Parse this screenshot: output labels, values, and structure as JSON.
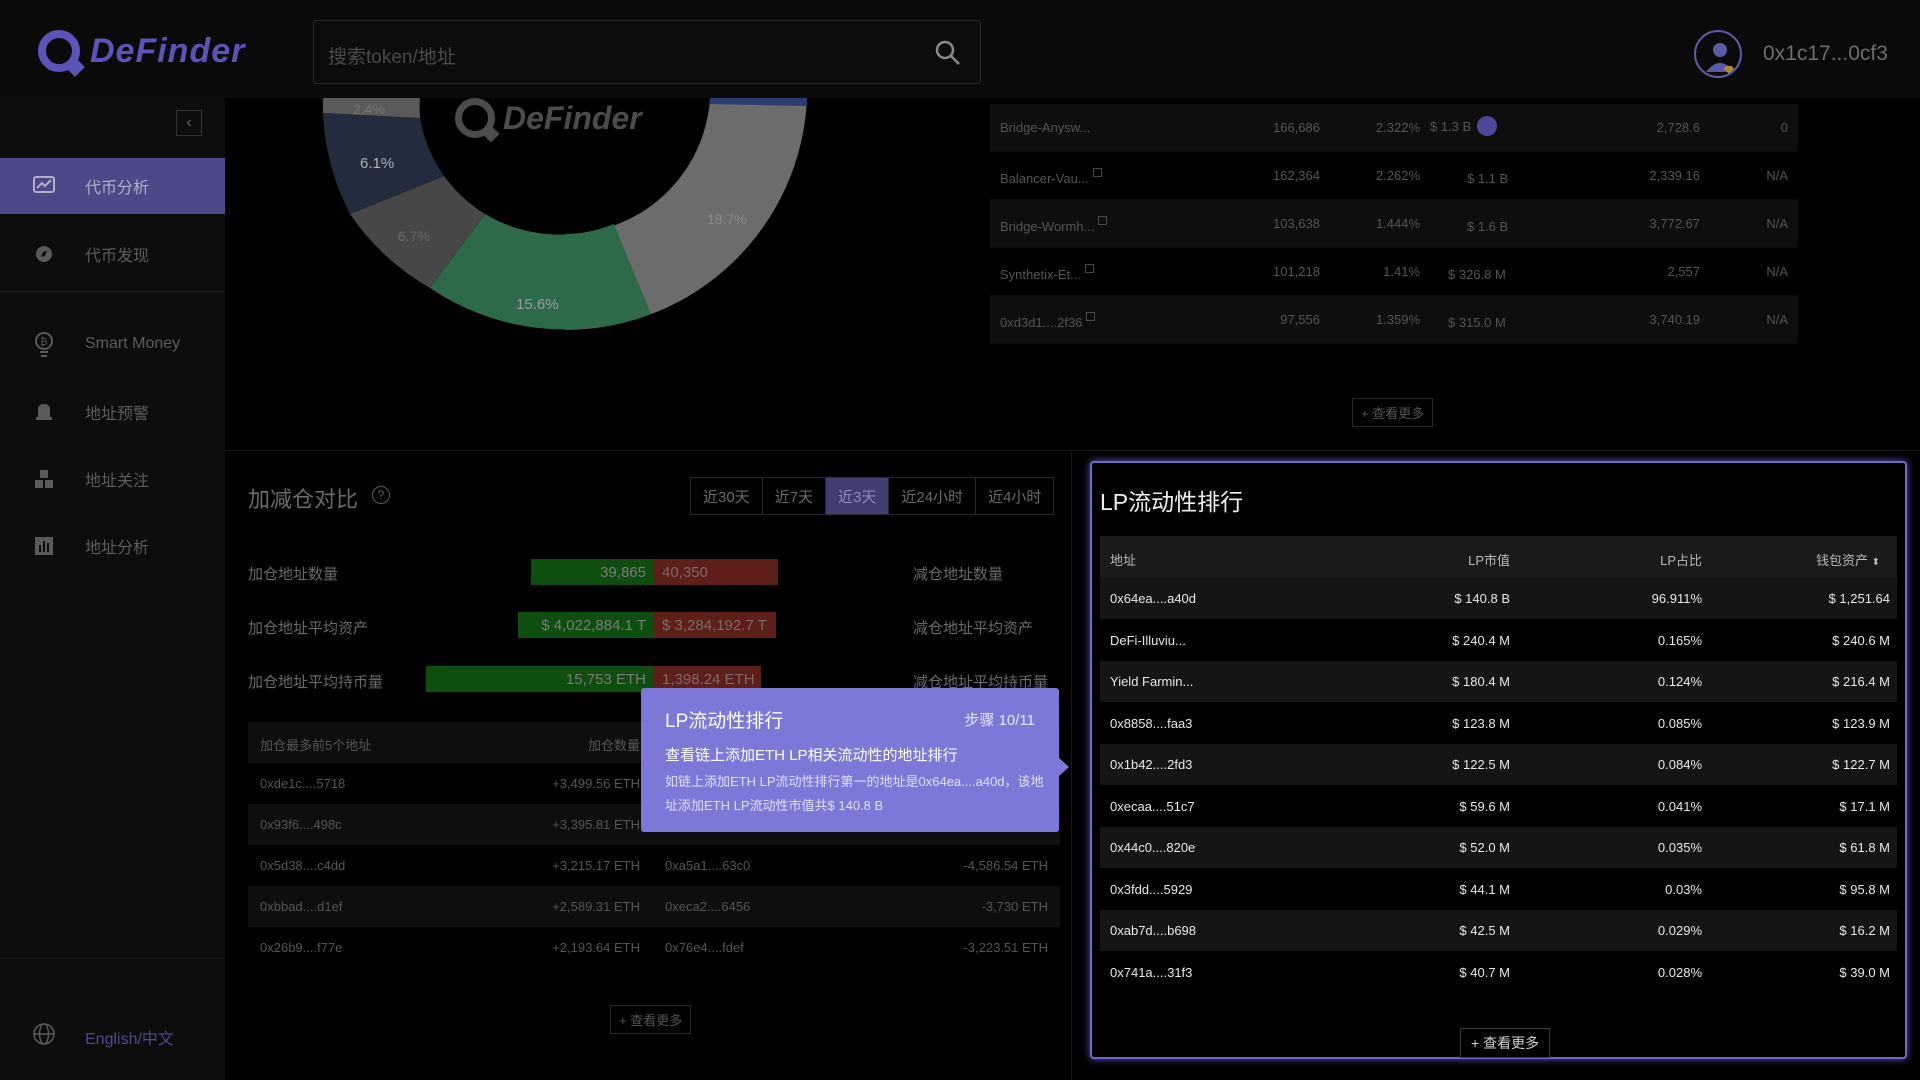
{
  "header": {
    "logo_text": "DeFinder",
    "search_placeholder": "搜索token/地址",
    "wallet_address": "0x1c17...0cf3"
  },
  "sidebar": {
    "items": [
      {
        "label": "代币分析",
        "icon": "chart-icon",
        "active": true
      },
      {
        "label": "代币发现",
        "icon": "compass-icon",
        "active": false
      },
      {
        "label": "Smart Money",
        "icon": "bulb-icon",
        "active": false
      },
      {
        "label": "地址预警",
        "icon": "bell-icon",
        "active": false
      },
      {
        "label": "地址关注",
        "icon": "cubes-icon",
        "active": false
      },
      {
        "label": "地址分析",
        "icon": "bar-chart-icon",
        "active": false
      }
    ],
    "language": "English/中文"
  },
  "donut": {
    "labels": [
      "2.4%",
      "6.1%",
      "6.7%",
      "15.6%",
      "18.7%"
    ]
  },
  "watermark_text": "DeFinder",
  "holders_table": {
    "rows": [
      {
        "name": "Bridge-Anysw...",
        "count": "166,686",
        "pct": "2.322%",
        "value": "$ 1.3 B",
        "num": "2,728.6",
        "extra": "0"
      },
      {
        "name": "Balancer-Vau...",
        "count": "162,364",
        "pct": "2.262%",
        "value": "$ 1.1 B",
        "num": "2,339.16",
        "extra": "N/A"
      },
      {
        "name": "Bridge-Wormh...",
        "count": "103,638",
        "pct": "1.444%",
        "value": "$ 1.6 B",
        "num": "3,772.67",
        "extra": "N/A"
      },
      {
        "name": "Synthetix-Et...",
        "count": "101,218",
        "pct": "1.41%",
        "value": "$ 326.8 M",
        "num": "2,557",
        "extra": "N/A"
      },
      {
        "name": "0xd3d1....2f36",
        "count": "97,556",
        "pct": "1.359%",
        "value": "$ 315.0 M",
        "num": "3,740.19",
        "extra": "N/A"
      }
    ],
    "more_label": "+ 查看更多"
  },
  "compare": {
    "title": "加减仓对比",
    "tabs": [
      "近30天",
      "近7天",
      "近3天",
      "近24小时",
      "近4小时"
    ],
    "active_tab": "近3天",
    "metrics": [
      {
        "left_label": "加仓地址数量",
        "green": "39,865",
        "red": "40,350",
        "right_label": "减仓地址数量"
      },
      {
        "left_label": "加仓地址平均资产",
        "green": "$ 4,022,884.1 T",
        "red": "$ 3,284,192.7 T",
        "right_label": "减仓地址平均资产"
      },
      {
        "left_label": "加仓地址平均持币量",
        "green": "15,753 ETH",
        "red": "1,398.24 ETH",
        "right_label": "减仓地址平均持币量"
      }
    ],
    "table_head": {
      "col1": "加仓最多前5个地址",
      "col2": "加仓数量"
    },
    "rows": [
      {
        "addr": "0xde1c....5718",
        "amt": "+3,499.56 ETH",
        "addr2": "",
        "amt2": ""
      },
      {
        "addr": "0x93f6....498c",
        "amt": "+3,395.81 ETH",
        "addr2": "",
        "amt2": ""
      },
      {
        "addr": "0x5d38....c4dd",
        "amt": "+3,215.17 ETH",
        "addr2": "0xa5a1....63c0",
        "amt2": "-4,586.54 ETH"
      },
      {
        "addr": "0xbbad....d1ef",
        "amt": "+2,589.31 ETH",
        "addr2": "0xeca2....6456",
        "amt2": "-3,730 ETH"
      },
      {
        "addr": "0x26b9....f77e",
        "amt": "+2,193.64 ETH",
        "addr2": "0x76e4....fdef",
        "amt2": "-3,223.51 ETH"
      }
    ],
    "more_label": "+ 查看更多"
  },
  "lp": {
    "title": "LP流动性排行",
    "headers": {
      "addr": "地址",
      "value": "LP市值",
      "pct": "LP占比",
      "wallet": "钱包资产"
    },
    "rows": [
      {
        "addr": "0x64ea....a40d",
        "value": "$ 140.8 B",
        "pct": "96.911%",
        "wallet": "$ 1,251.64"
      },
      {
        "addr": "DeFi-Illuviu...",
        "value": "$ 240.4 M",
        "pct": "0.165%",
        "wallet": "$ 240.6 M"
      },
      {
        "addr": "Yield Farmin...",
        "value": "$ 180.4 M",
        "pct": "0.124%",
        "wallet": "$ 216.4 M"
      },
      {
        "addr": "0x8858....faa3",
        "value": "$ 123.8 M",
        "pct": "0.085%",
        "wallet": "$ 123.9 M"
      },
      {
        "addr": "0x1b42....2fd3",
        "value": "$ 122.5 M",
        "pct": "0.084%",
        "wallet": "$ 122.7 M"
      },
      {
        "addr": "0xecaa....51c7",
        "value": "$ 59.6 M",
        "pct": "0.041%",
        "wallet": "$ 17.1 M"
      },
      {
        "addr": "0x44c0....820e",
        "value": "$ 52.0 M",
        "pct": "0.035%",
        "wallet": "$ 61.8 M"
      },
      {
        "addr": "0x3fdd....5929",
        "value": "$ 44.1 M",
        "pct": "0.03%",
        "wallet": "$ 95.8 M"
      },
      {
        "addr": "0xab7d....b698",
        "value": "$ 42.5 M",
        "pct": "0.029%",
        "wallet": "$ 16.2 M"
      },
      {
        "addr": "0x741a....31f3",
        "value": "$ 40.7 M",
        "pct": "0.028%",
        "wallet": "$ 39.0 M"
      }
    ],
    "more_label": "+ 查看更多"
  },
  "tooltip": {
    "title": "LP流动性排行",
    "step": "步骤 10/11",
    "subtitle": "查看链上添加ETH LP相关流动性的地址排行",
    "description": "如链上添加ETH LP流动性排行第一的地址是0x64ea....a40d，该地址添加ETH LP流动性市值共$ 140.8 B"
  },
  "colors": {
    "accent": "#7b78d8",
    "active_nav": "#4b4987",
    "bar_green": "#0e4e0e",
    "bar_red": "#5e1e1a"
  }
}
